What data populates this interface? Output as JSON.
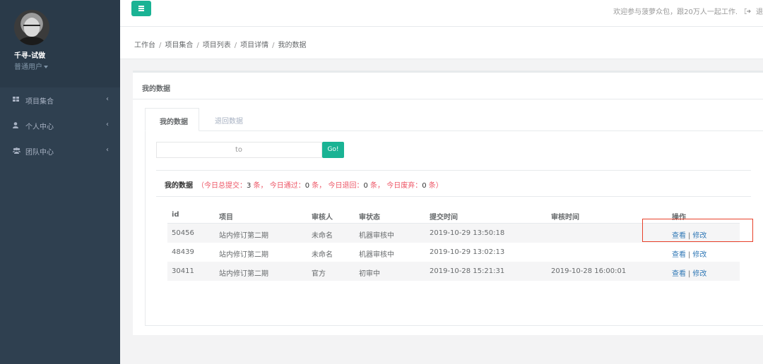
{
  "sidebar": {
    "user_name": "千寻-试做",
    "user_role": "普通用户",
    "items": [
      {
        "label": "项目集合",
        "icon": "grid-icon"
      },
      {
        "label": "个人中心",
        "icon": "user-icon"
      },
      {
        "label": "团队中心",
        "icon": "group-icon"
      }
    ],
    "chevron": "‹"
  },
  "topbar": {
    "welcome": "欢迎参与菠萝众包，跟20万人一起工作.",
    "logout_label": "退"
  },
  "breadcrumb": [
    "工作台",
    "项目集合",
    "项目列表",
    "项目详情",
    "我的数据"
  ],
  "panel": {
    "title": "我的数据",
    "tabs": [
      {
        "label": "我的数据",
        "active": true
      },
      {
        "label": "退回数据",
        "active": false
      }
    ],
    "date_from_value": "",
    "to_label": "to",
    "date_to_value": "",
    "go_label": "Go!"
  },
  "summary": {
    "title": "我的数据",
    "open": "（今日总提交：",
    "submitted": "3",
    "unit1": " 条，  今日通过：",
    "passed": "0",
    "unit2": " 条，  今日退回：",
    "returned": "0",
    "unit3": " 条，  今日废弃：",
    "discarded": "0",
    "close": " 条）"
  },
  "table": {
    "headers": [
      "id",
      "项目",
      "审核人",
      "审状态",
      "提交时间",
      "审核时间",
      "操作"
    ],
    "rows": [
      {
        "id": "50456",
        "project": "站内修订第二期",
        "reviewer": "未命名",
        "status": "机器审核中",
        "submitted": "2019-10-29 13:50:18",
        "reviewed": "",
        "view": "查看",
        "edit": "修改"
      },
      {
        "id": "48439",
        "project": "站内修订第二期",
        "reviewer": "未命名",
        "status": "机器审核中",
        "submitted": "2019-10-29 13:02:13",
        "reviewed": "",
        "view": "查看",
        "edit": "修改"
      },
      {
        "id": "30411",
        "project": "站内修订第二期",
        "reviewer": "官方",
        "status": "初审中",
        "submitted": "2019-10-28 15:21:31",
        "reviewed": "2019-10-28 16:00:01",
        "view": "查看",
        "edit": "修改"
      }
    ],
    "pipe": "|"
  },
  "colors": {
    "sidebar": "#2f4050",
    "accent": "#1ab394",
    "link": "#337ab7",
    "stats": "#ed5565",
    "highlight": "#e8402a"
  }
}
